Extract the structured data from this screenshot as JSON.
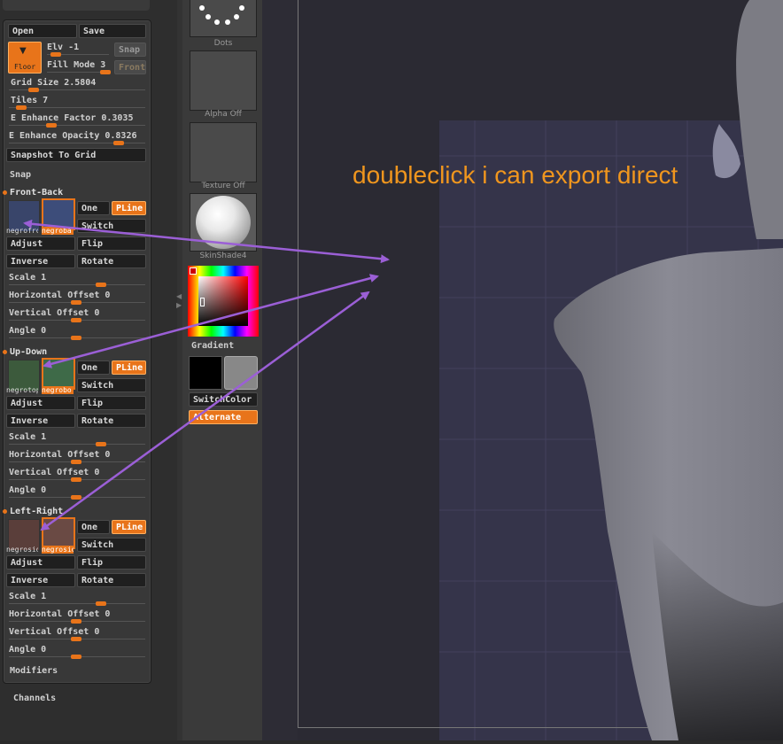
{
  "toolbar": {
    "open": "Open",
    "save": "Save",
    "floor": "Floor",
    "elv": "Elv -1",
    "snap": "Snap",
    "fill_mode": "Fill Mode 3",
    "front": "Front",
    "grid_size": "Grid Size 2.5804",
    "tiles": "Tiles 7",
    "e_enhance_factor": "E Enhance Factor 0.3035",
    "e_enhance_opacity": "E Enhance Opacity 0.8326",
    "snapshot_to_grid": "Snapshot To Grid",
    "snap_section": "Snap"
  },
  "sections": [
    {
      "title": "Front-Back",
      "thumb1": "negrofro",
      "thumb2": "negroba",
      "one": "One",
      "pline": "PLine",
      "switch": "Switch",
      "adjust": "Adjust",
      "flip": "Flip",
      "inverse": "Inverse",
      "rotate": "Rotate",
      "scale": "Scale 1",
      "hoffset": "Horizontal Offset 0",
      "voffset": "Vertical Offset 0",
      "angle": "Angle 0"
    },
    {
      "title": "Up-Down",
      "thumb1": "negrotop",
      "thumb2": "negrobo",
      "one": "One",
      "pline": "PLine",
      "switch": "Switch",
      "adjust": "Adjust",
      "flip": "Flip",
      "inverse": "Inverse",
      "rotate": "Rotate",
      "scale": "Scale 1",
      "hoffset": "Horizontal Offset 0",
      "voffset": "Vertical Offset 0",
      "angle": "Angle 0"
    },
    {
      "title": "Left-Right",
      "thumb1": "negrosid",
      "thumb2": "negrosid",
      "one": "One",
      "pline": "PLine",
      "switch": "Switch",
      "adjust": "Adjust",
      "flip": "Flip",
      "inverse": "Inverse",
      "rotate": "Rotate",
      "scale": "Scale 1",
      "hoffset": "Horizontal Offset 0",
      "voffset": "Vertical Offset 0",
      "angle": "Angle 0"
    }
  ],
  "modifiers": "Modifiers",
  "channels": "Channels",
  "middle": {
    "dots": "Dots",
    "alpha": "Alpha Off",
    "texture": "Texture Off",
    "material": "SkinShade4",
    "gradient": "Gradient",
    "switch_color": "SwitchColor",
    "alternate": "Alternate"
  },
  "annotation": "doubleclick i can export direct",
  "colors": {
    "accent": "#e8741a",
    "arrow": "#9b5fd6",
    "annotation": "#f0961e"
  }
}
